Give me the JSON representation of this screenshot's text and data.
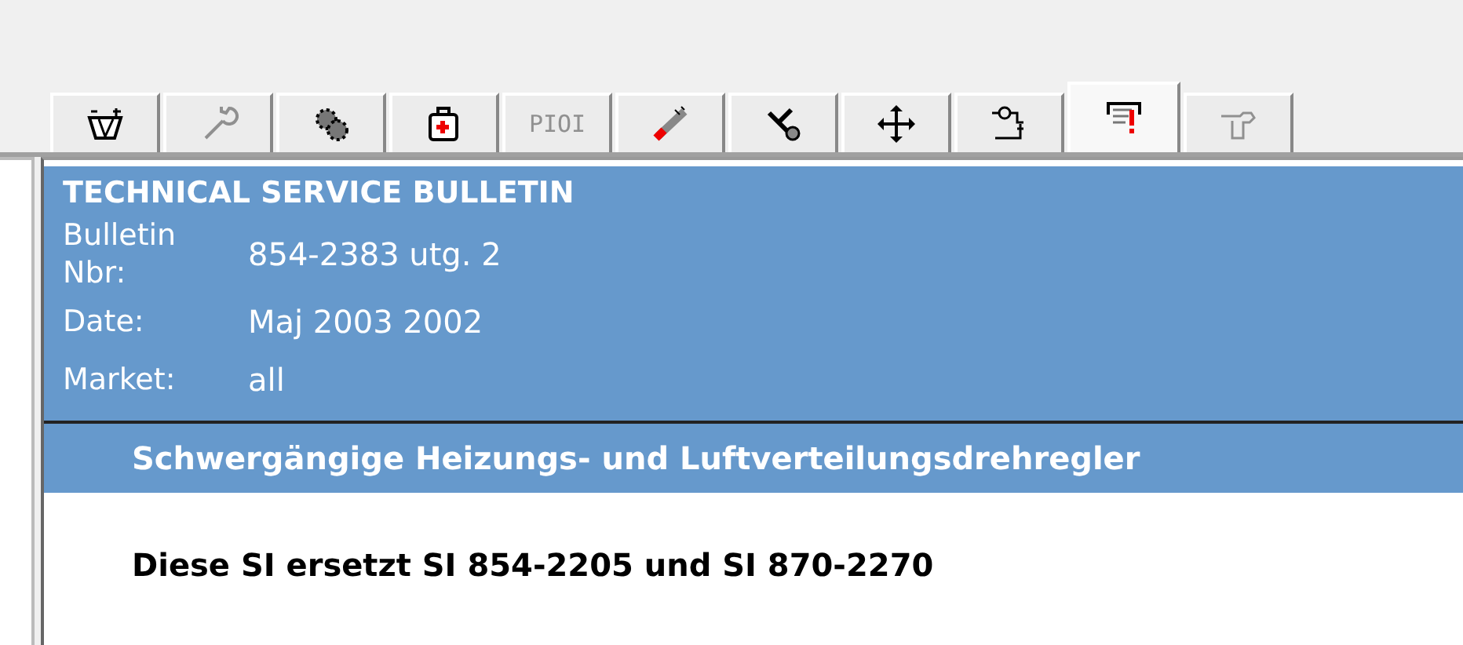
{
  "tabs": [
    {
      "kind": "icon",
      "selected": false,
      "disabled": false
    },
    {
      "kind": "icon",
      "selected": false,
      "disabled": true
    },
    {
      "kind": "icon",
      "selected": false,
      "disabled": false
    },
    {
      "kind": "icon",
      "selected": false,
      "disabled": false
    },
    {
      "kind": "text",
      "label": "PIOI",
      "selected": false,
      "disabled": true
    },
    {
      "kind": "icon",
      "selected": false,
      "disabled": false
    },
    {
      "kind": "icon",
      "selected": false,
      "disabled": false
    },
    {
      "kind": "icon",
      "selected": false,
      "disabled": false
    },
    {
      "kind": "icon",
      "selected": false,
      "disabled": false
    },
    {
      "kind": "icon",
      "selected": true,
      "disabled": false
    },
    {
      "kind": "icon",
      "selected": false,
      "disabled": true
    }
  ],
  "bulletin": {
    "heading": "TECHNICAL SERVICE BULLETIN",
    "fields": [
      {
        "label": "Bulletin Nbr:",
        "value": "854-2383 utg. 2"
      },
      {
        "label": "Date:",
        "value": "Maj 2003 2002"
      },
      {
        "label": "Market:",
        "value": "all"
      }
    ],
    "title": "Schwergängige Heizungs- und Luftverteilungsdrehregler",
    "body": "Diese SI ersetzt SI 854-2205 und SI 870-2270"
  }
}
